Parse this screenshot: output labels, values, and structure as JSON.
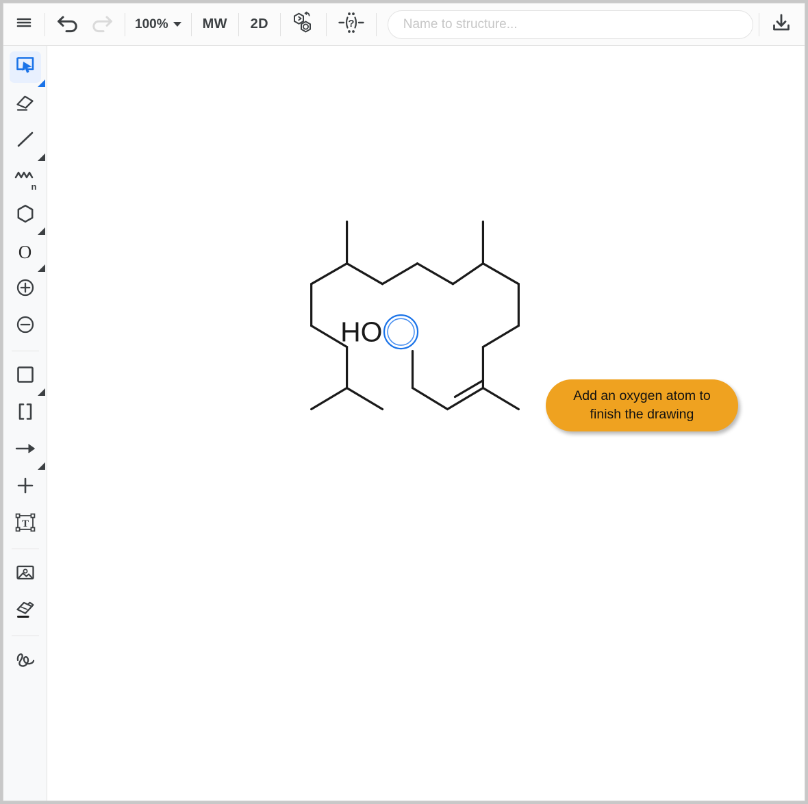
{
  "app": {
    "title": "Chemical Structure Editor",
    "canvas_background": "#ffffff",
    "accent_color": "#1a73e8",
    "tooltip_color": "#efa220"
  },
  "toolbar": {
    "menu_label": "Menu",
    "undo_label": "Undo",
    "redo_label": "Redo",
    "zoom_value": "100%",
    "mw_label": "MW",
    "dimension_label": "2D",
    "aromatize_label": "Aromatize / Dearomatize",
    "query_label": "Explicit hydrogens",
    "save_label": "Save / Download",
    "icons": {
      "menu": "hamburger-menu-icon",
      "undo": "undo-arrow-icon",
      "redo": "redo-arrow-icon",
      "zoom_caret": "chevron-down-icon",
      "aromatize": "aromatize-hexagons-icon",
      "query": "query-atom-icon",
      "save": "download-icon"
    },
    "undo_enabled": true,
    "redo_enabled": false
  },
  "search": {
    "placeholder": "Name to structure...",
    "value": ""
  },
  "sidebar": {
    "items": [
      {
        "name": "selection-tool",
        "label": "Select / Rectangle selection",
        "icon": "cursor-select-icon",
        "active": true,
        "has_submenu": true
      },
      {
        "name": "eraser-tool",
        "label": "Erase",
        "icon": "eraser-icon",
        "active": false,
        "has_submenu": false
      },
      {
        "name": "bond-tool",
        "label": "Single bond",
        "icon": "bond-line-icon",
        "active": false,
        "has_submenu": true
      },
      {
        "name": "chain-tool",
        "label": "Chain",
        "icon": "zigzag-chain-icon",
        "active": false,
        "has_submenu": false,
        "badge": "n"
      },
      {
        "name": "ring-tool",
        "label": "Ring / Benzene",
        "icon": "hexagon-ring-icon",
        "active": false,
        "has_submenu": true
      },
      {
        "name": "atom-tool",
        "label": "Atom O",
        "icon": "atom-oxygen-icon",
        "active": false,
        "has_submenu": true,
        "glyph": "O"
      },
      {
        "name": "charge-plus-tool",
        "label": "Increase charge",
        "icon": "plus-circle-icon",
        "active": false,
        "has_submenu": false
      },
      {
        "name": "charge-minus-tool",
        "label": "Decrease charge",
        "icon": "minus-circle-icon",
        "active": false,
        "has_submenu": false
      },
      {
        "name": "rectangle-tool",
        "label": "Rectangle shape",
        "icon": "square-shape-icon",
        "active": false,
        "has_submenu": true
      },
      {
        "name": "brackets-tool",
        "label": "Brackets",
        "icon": "brackets-icon",
        "active": false,
        "has_submenu": false
      },
      {
        "name": "arrow-tool",
        "label": "Reaction arrow",
        "icon": "arrow-right-icon",
        "active": false,
        "has_submenu": true
      },
      {
        "name": "plus-tool",
        "label": "Reaction plus",
        "icon": "plus-sign-icon",
        "active": false,
        "has_submenu": false
      },
      {
        "name": "text-tool",
        "label": "Text box",
        "icon": "text-box-icon",
        "active": false,
        "has_submenu": false
      },
      {
        "name": "image-tool",
        "label": "Insert image",
        "icon": "image-icon",
        "active": false,
        "has_submenu": false
      },
      {
        "name": "clean-tool",
        "label": "Clean / Erase shape",
        "icon": "shape-eraser-icon",
        "active": false,
        "has_submenu": false
      },
      {
        "name": "freehand-tool",
        "label": "Freehand drawing",
        "icon": "squiggle-icon",
        "active": false,
        "has_submenu": false
      }
    ]
  },
  "canvas": {
    "structure": {
      "selected_atom_label": "HO",
      "selected_atom_element": "O",
      "selection_highlight_color": "#1a73e8",
      "bond_color": "#1a1a1a",
      "bond_width": 3.2,
      "description": "Macrocyclic terpenoid ring bearing an alcohol, isopropyl and methyl substituents, with one cis double bond"
    }
  },
  "tooltip": {
    "line1": "Add an oxygen atom to",
    "line2": "finish the drawing",
    "full_text": "Add an oxygen atom to finish the drawing",
    "background": "#efa220"
  }
}
